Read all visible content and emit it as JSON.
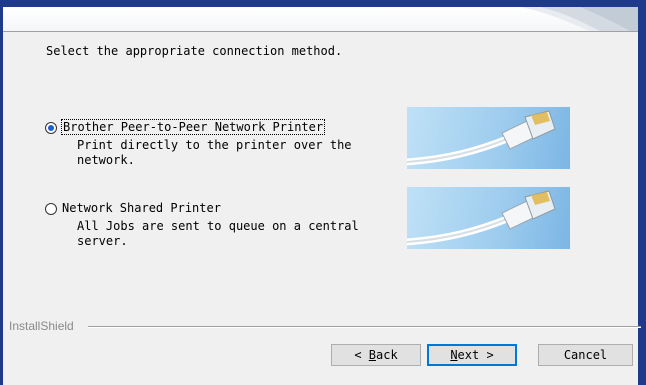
{
  "dialog": {
    "instruction": "Select the appropriate connection method."
  },
  "options": [
    {
      "label": "Brother Peer-to-Peer Network Printer",
      "description": "Print directly to the printer over the\nnetwork.",
      "selected": true
    },
    {
      "label": "Network Shared Printer",
      "description": "All Jobs are sent to queue on a central\nserver.",
      "selected": false
    }
  ],
  "footer": {
    "brand": "InstallShield"
  },
  "buttons": {
    "back": {
      "prefix": "< ",
      "mnemonic": "B",
      "rest": "ack"
    },
    "next": {
      "mnemonic": "N",
      "rest": "ext",
      "suffix": " >"
    },
    "cancel": "Cancel"
  },
  "colors": {
    "title_bar": "#1f3a8a",
    "radio_selected": "#1a5fd6",
    "image_background": "#9fcdee"
  },
  "icons": [
    "ethernet-cable-image",
    "ethernet-cable-image"
  ]
}
